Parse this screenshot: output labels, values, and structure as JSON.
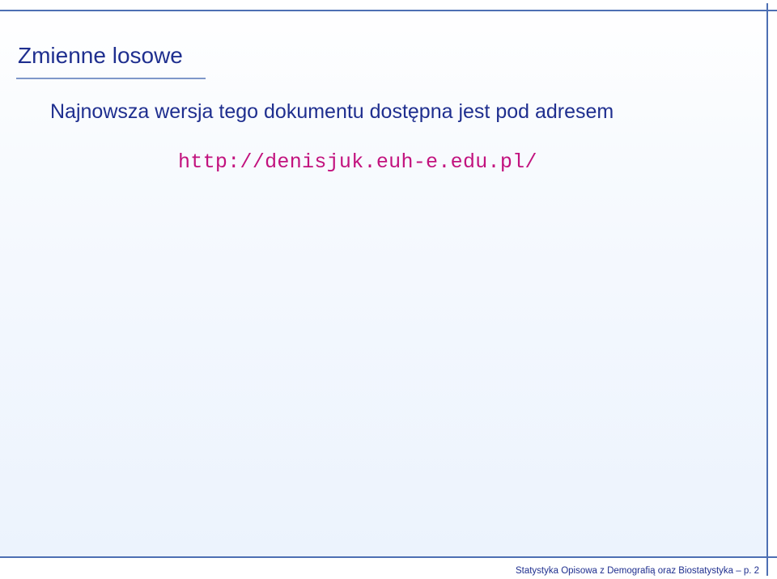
{
  "slide": {
    "title": "Zmienne losowe",
    "intro_text": "Najnowsza wersja tego dokumentu dostępna jest pod adresem",
    "url": "http://denisjuk.euh-e.edu.pl/"
  },
  "footer": {
    "text": "Statystyka Opisowa z Demografią oraz Biostatystyka – p. 2"
  },
  "colors": {
    "title": "#1f2f8f",
    "frame": "#4d6fb3",
    "url": "#c2127e"
  }
}
